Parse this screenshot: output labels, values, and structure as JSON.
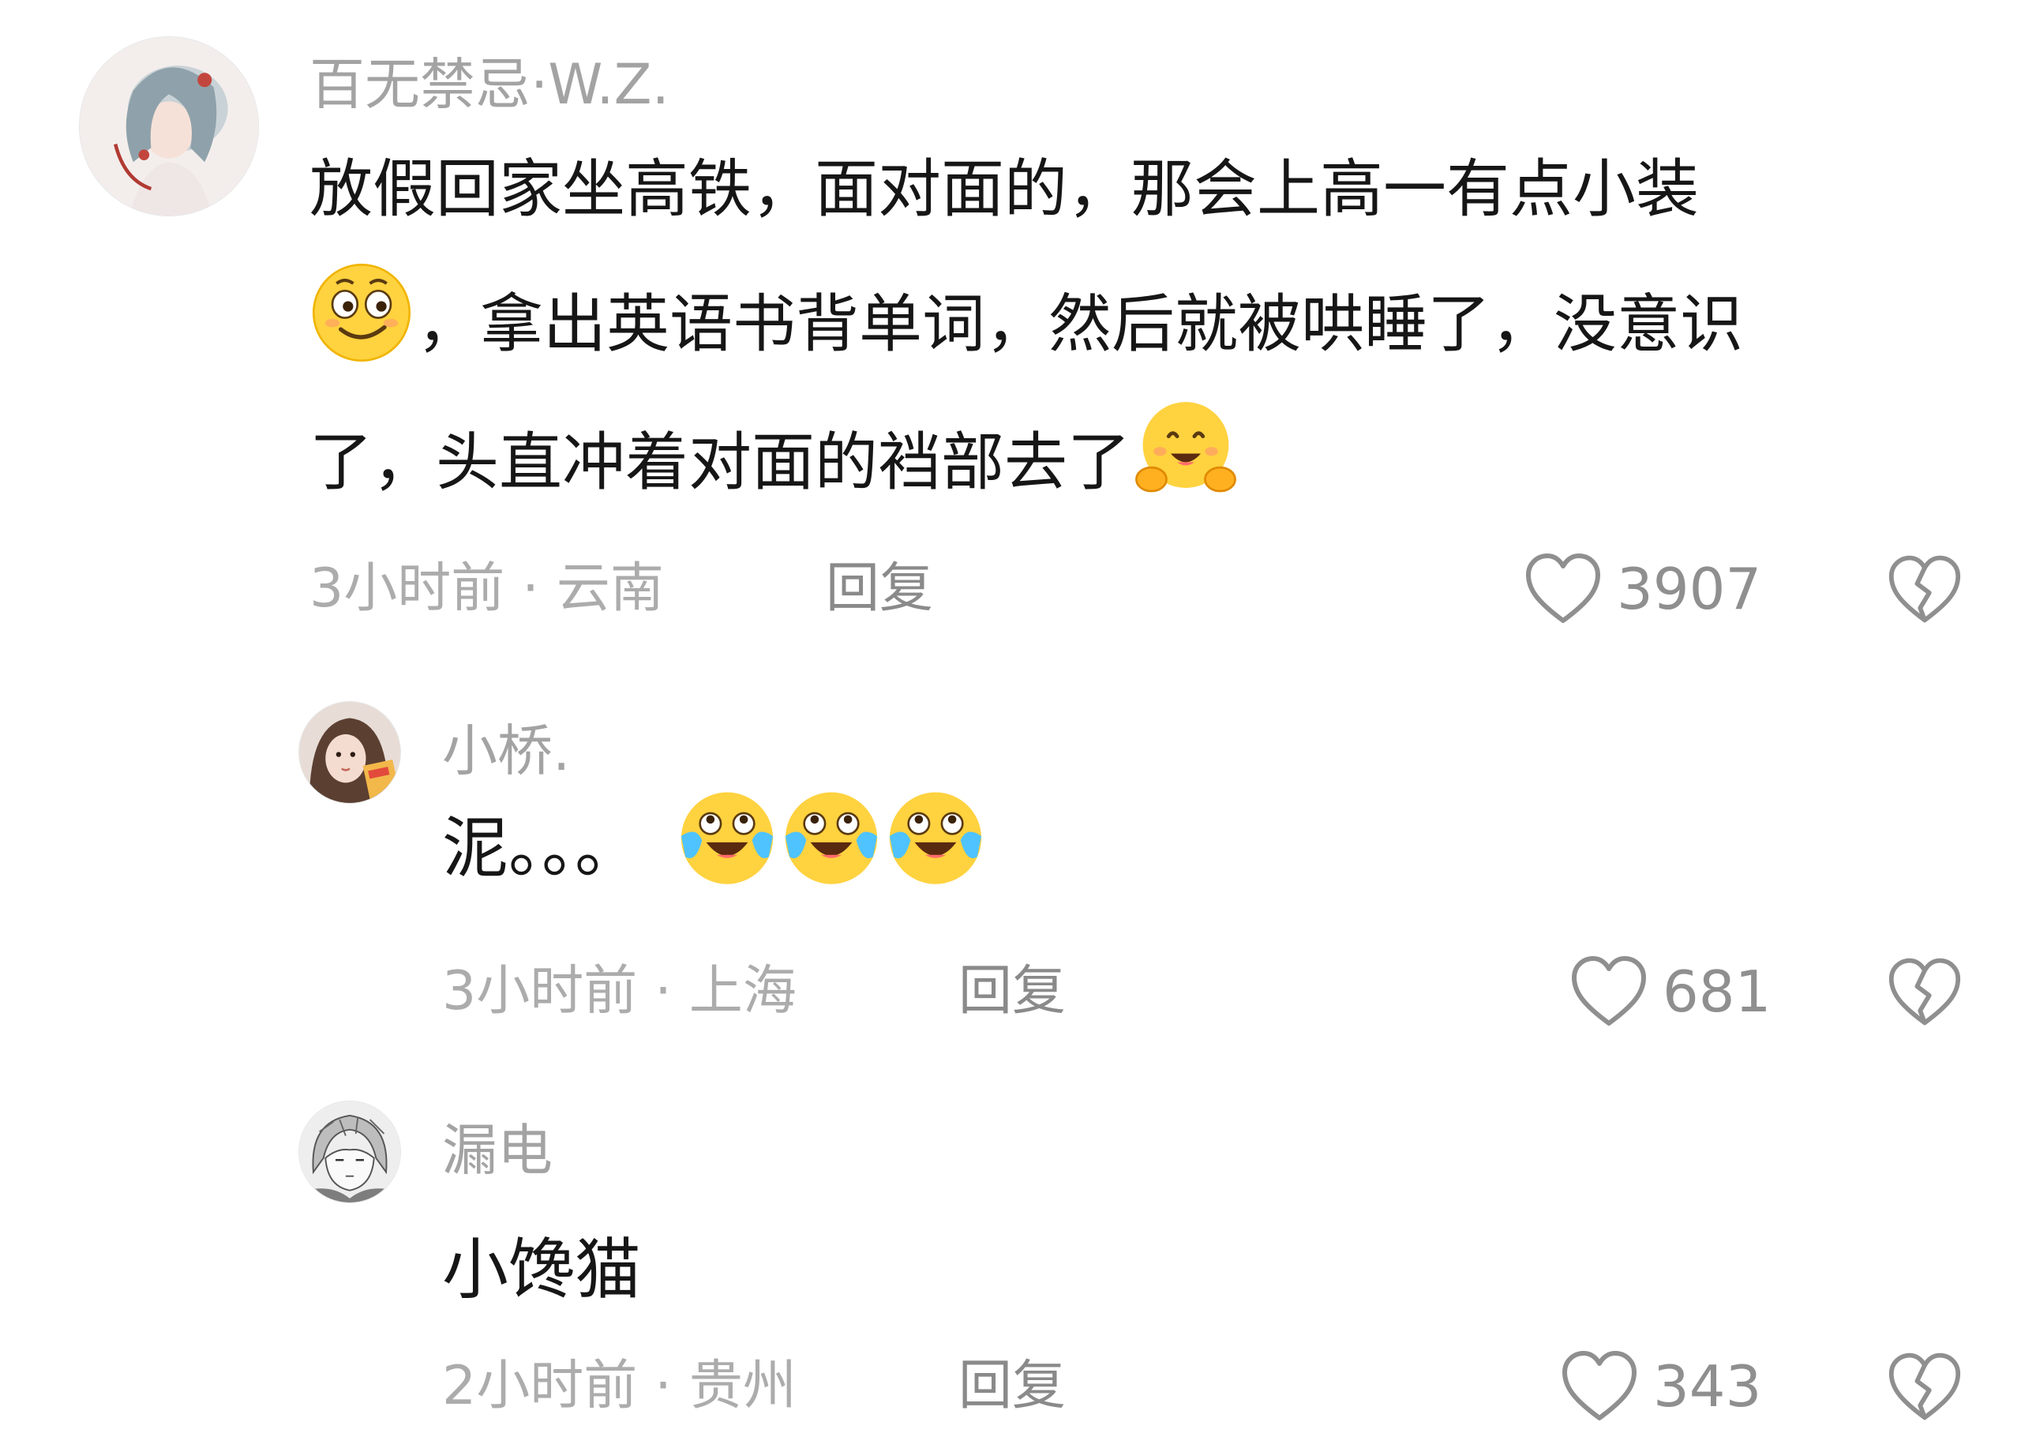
{
  "comments": [
    {
      "username": "百无禁忌·W.Z.",
      "content_line1": "放假回家坐高铁，面对面的，那会上高一有点小装",
      "content_line2a": "，拿出英语书背单词，然后就被哄睡了，没意识",
      "content_line3a": "了，头直冲着对面的裆部去了",
      "time": "3小时前",
      "location": "云南",
      "reply_label": "回复",
      "likes": "3907",
      "emojis": [
        "smirk-face-icon",
        "hug-face-icon"
      ]
    }
  ],
  "replies": [
    {
      "username": "小桥.",
      "content": "泥。。。",
      "time": "3小时前",
      "location": "上海",
      "reply_label": "回复",
      "likes": "681",
      "emojis": [
        "crying-laughing-face-icon",
        "crying-laughing-face-icon",
        "crying-laughing-face-icon"
      ]
    },
    {
      "username": "漏电",
      "content": "小馋猫",
      "time": "2小时前",
      "location": "贵州",
      "reply_label": "回复",
      "likes": "343"
    }
  ],
  "separator": "·",
  "colors": {
    "username": "#a3a3a3",
    "content": "#161616",
    "meta": "#acacac",
    "icon": "#8f8f8f"
  }
}
